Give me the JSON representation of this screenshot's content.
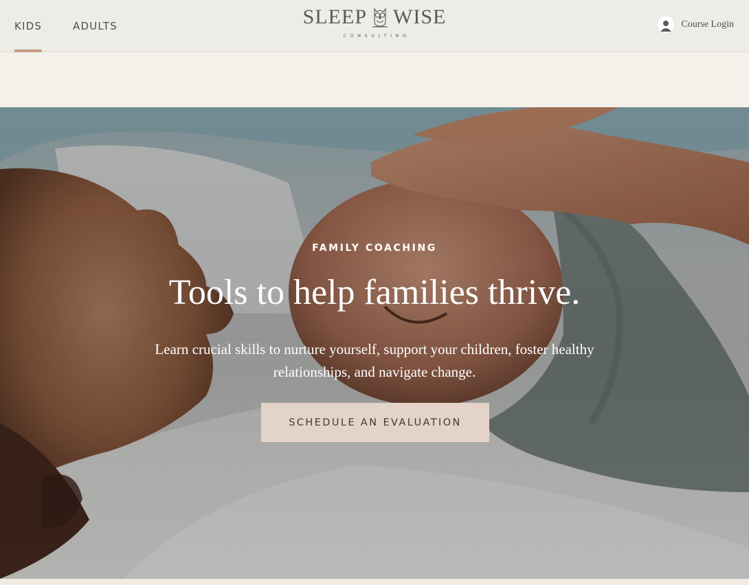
{
  "nav": {
    "tabs": [
      {
        "label": "KIDS",
        "active": true
      },
      {
        "label": "ADULTS",
        "active": false
      }
    ],
    "accent_color": "#c59a86"
  },
  "logo": {
    "word_left": "SLEEP",
    "word_right": "WISE",
    "tagline": "CONSULTING",
    "icon": "owl-icon"
  },
  "login": {
    "label": "Course Login",
    "icon": "user-avatar-icon"
  },
  "hero": {
    "eyebrow": "FAMILY COACHING",
    "headline": "Tools to help families thrive.",
    "subtext": "Learn crucial skills to nurture yourself, support your children, foster healthy relationships, and navigate change.",
    "cta_label": "SCHEDULE AN EVALUATION",
    "cta_color": "#e4d3c8"
  }
}
